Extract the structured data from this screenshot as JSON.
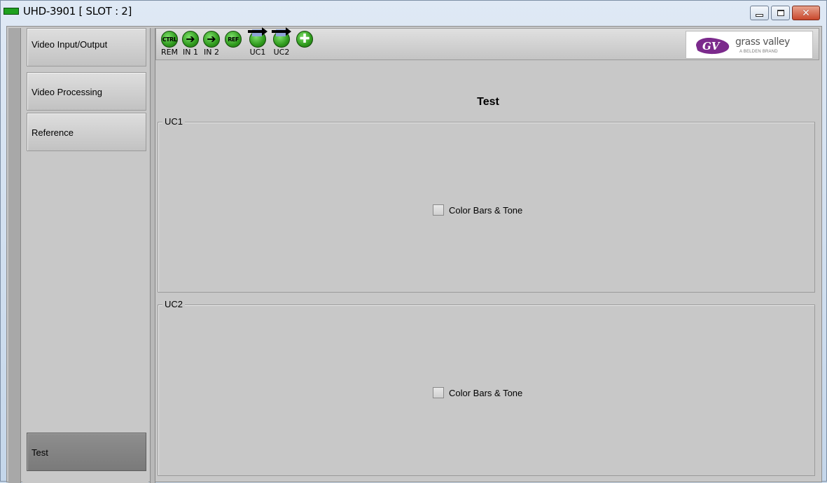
{
  "window": {
    "title": "UHD-3901 [ SLOT : 2]",
    "controls": [
      "minimize",
      "maximize",
      "close"
    ]
  },
  "sidebar": {
    "items": [
      {
        "label": "Video Input/Output",
        "active": false
      },
      {
        "label": "Video Processing",
        "active": false
      },
      {
        "label": "Reference",
        "active": false
      },
      {
        "label": "Test",
        "active": true
      }
    ]
  },
  "toolbar": {
    "status_icons": [
      {
        "icon": "ctrl-rem-icon",
        "circle_text": "CTRL",
        "label": "REM"
      },
      {
        "icon": "in1-arrow-icon",
        "circle_text": "",
        "label": "IN 1"
      },
      {
        "icon": "in2-arrow-icon",
        "circle_text": "",
        "label": "IN 2"
      },
      {
        "icon": "ref-icon",
        "circle_text": "REF",
        "label": ""
      },
      {
        "icon": "uc1-icon",
        "circle_text": "",
        "label": "UC1"
      },
      {
        "icon": "uc2-icon",
        "circle_text": "",
        "label": "UC2"
      },
      {
        "icon": "plus-icon",
        "circle_text": "",
        "label": ""
      }
    ],
    "logo": {
      "name": "grass valley",
      "sub": "A BELDEN BRAND",
      "brand_color": "#7b2a8c"
    }
  },
  "panel": {
    "title": "Test",
    "groups": [
      {
        "legend": "UC1",
        "checkbox_label": "Color Bars & Tone",
        "checked": false
      },
      {
        "legend": "UC2",
        "checkbox_label": "Color Bars & Tone",
        "checked": false
      }
    ]
  },
  "colors": {
    "status_green": "#2f9a1d",
    "active_tab": "#858585",
    "panel_bg": "#c8c8c8"
  }
}
